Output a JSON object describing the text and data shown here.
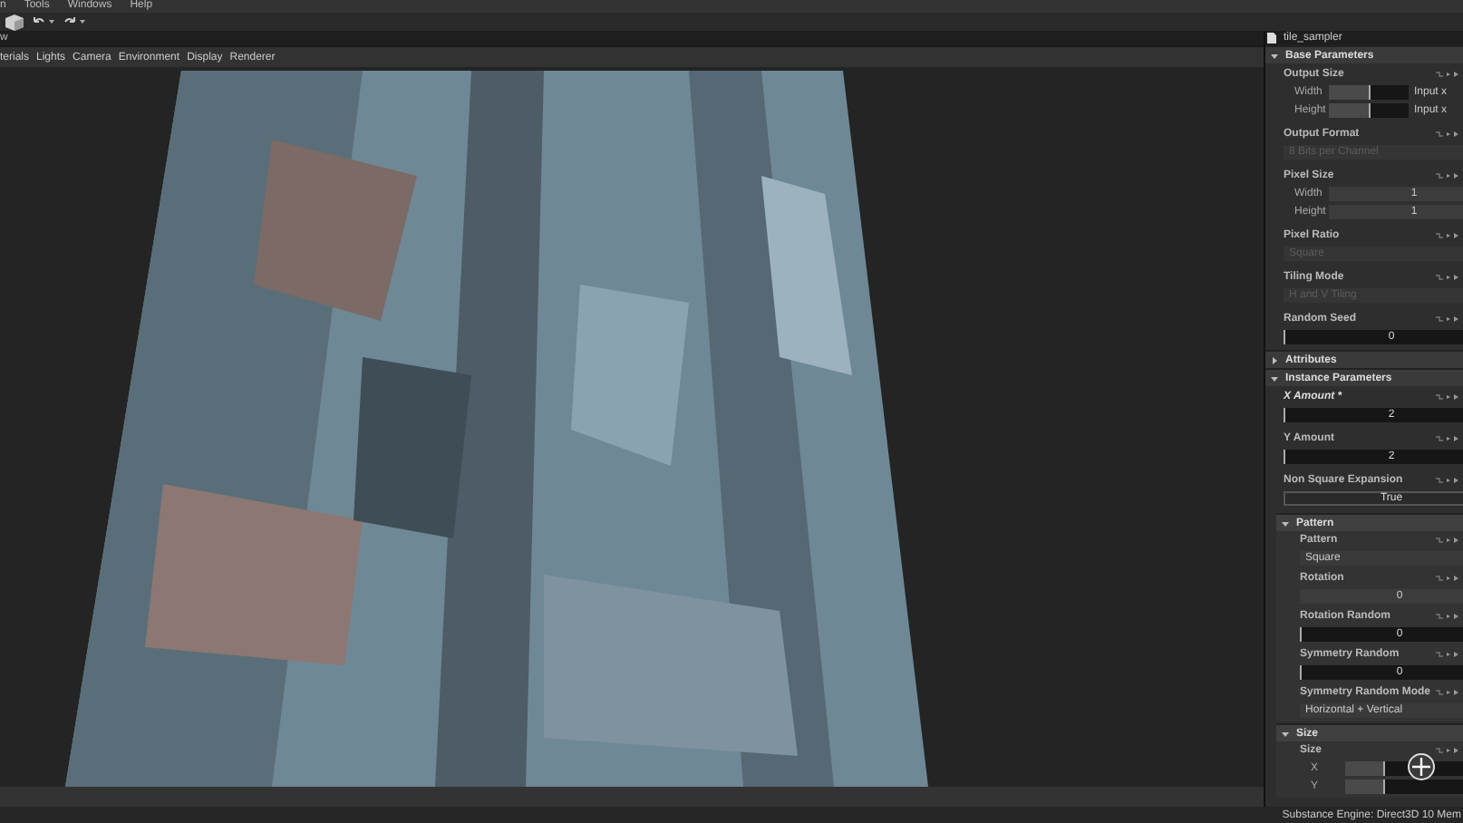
{
  "menu": [
    "n",
    "Tools",
    "Windows",
    "Help"
  ],
  "viewport": {
    "title": "w",
    "tabs": [
      "terials",
      "Lights",
      "Camera",
      "Environment",
      "Display",
      "Renderer"
    ],
    "status": "Substance Engine: Direct3D 10  Mem"
  },
  "panel": {
    "title": "tile_sampler",
    "sections": [
      {
        "label": "Base Parameters",
        "expanded": true,
        "children": [
          {
            "kind": "param",
            "label": "Output Size",
            "modified": false,
            "rows": [
              {
                "kind": "slider",
                "sublabel": "Width",
                "level": 0.5,
                "suffix": "Input x"
              },
              {
                "kind": "slider",
                "sublabel": "Height",
                "level": 0.5,
                "suffix": "Input x"
              }
            ]
          },
          {
            "kind": "param",
            "label": "Output Format",
            "modified": false,
            "rows": [
              {
                "kind": "dropdown",
                "value": "8 Bits per Channel",
                "disabled": true
              }
            ]
          },
          {
            "kind": "param",
            "label": "Pixel Size",
            "modified": false,
            "rows": [
              {
                "kind": "field",
                "sublabel": "Width",
                "value": "1"
              },
              {
                "kind": "field",
                "sublabel": "Height",
                "value": "1"
              }
            ]
          },
          {
            "kind": "param",
            "label": "Pixel Ratio",
            "modified": false,
            "rows": [
              {
                "kind": "dropdown",
                "value": "Square",
                "disabled": true
              }
            ]
          },
          {
            "kind": "param",
            "label": "Tiling Mode",
            "modified": false,
            "rows": [
              {
                "kind": "dropdown",
                "value": "H and V Tiling",
                "disabled": true
              }
            ]
          },
          {
            "kind": "param",
            "label": "Random Seed",
            "modified": false,
            "rows": [
              {
                "kind": "slider",
                "value": "0",
                "level": 0
              }
            ]
          }
        ]
      },
      {
        "label": "Attributes",
        "expanded": false
      },
      {
        "label": "Instance Parameters",
        "expanded": true,
        "children": [
          {
            "kind": "param",
            "label": "X Amount *",
            "modified": true,
            "rows": [
              {
                "kind": "slider",
                "value": "2",
                "level": 0
              }
            ]
          },
          {
            "kind": "param",
            "label": "Y Amount",
            "modified": false,
            "rows": [
              {
                "kind": "slider",
                "value": "2",
                "level": 0
              }
            ]
          },
          {
            "kind": "param",
            "label": "Non Square Expansion",
            "modified": false,
            "rows": [
              {
                "kind": "toggle",
                "value": "True"
              }
            ]
          },
          {
            "kind": "section",
            "label": "Pattern",
            "expanded": true,
            "children": [
              {
                "kind": "param",
                "label": "Pattern",
                "modified": false,
                "rows": [
                  {
                    "kind": "dropdown",
                    "value": "Square",
                    "disabled": false
                  }
                ]
              },
              {
                "kind": "param",
                "label": "Rotation",
                "modified": false,
                "rows": [
                  {
                    "kind": "field",
                    "value": "0"
                  }
                ]
              },
              {
                "kind": "param",
                "label": "Rotation Random",
                "modified": false,
                "rows": [
                  {
                    "kind": "slider",
                    "value": "0",
                    "level": 0
                  }
                ]
              },
              {
                "kind": "param",
                "label": "Symmetry Random",
                "modified": false,
                "rows": [
                  {
                    "kind": "slider",
                    "value": "0",
                    "level": 0
                  }
                ]
              },
              {
                "kind": "param",
                "label": "Symmetry Random Mode",
                "modified": false,
                "rows": [
                  {
                    "kind": "dropdown",
                    "value": "Horizontal + Vertical",
                    "disabled": false
                  }
                ]
              }
            ]
          },
          {
            "kind": "section",
            "label": "Size",
            "expanded": true,
            "children": [
              {
                "kind": "param",
                "label": "Size",
                "modified": false,
                "rows": [
                  {
                    "kind": "slider",
                    "sublabel": "X",
                    "level": 0.25
                  },
                  {
                    "kind": "slider",
                    "sublabel": "Y",
                    "level": 0.25
                  }
                ]
              }
            ]
          }
        ]
      }
    ]
  }
}
